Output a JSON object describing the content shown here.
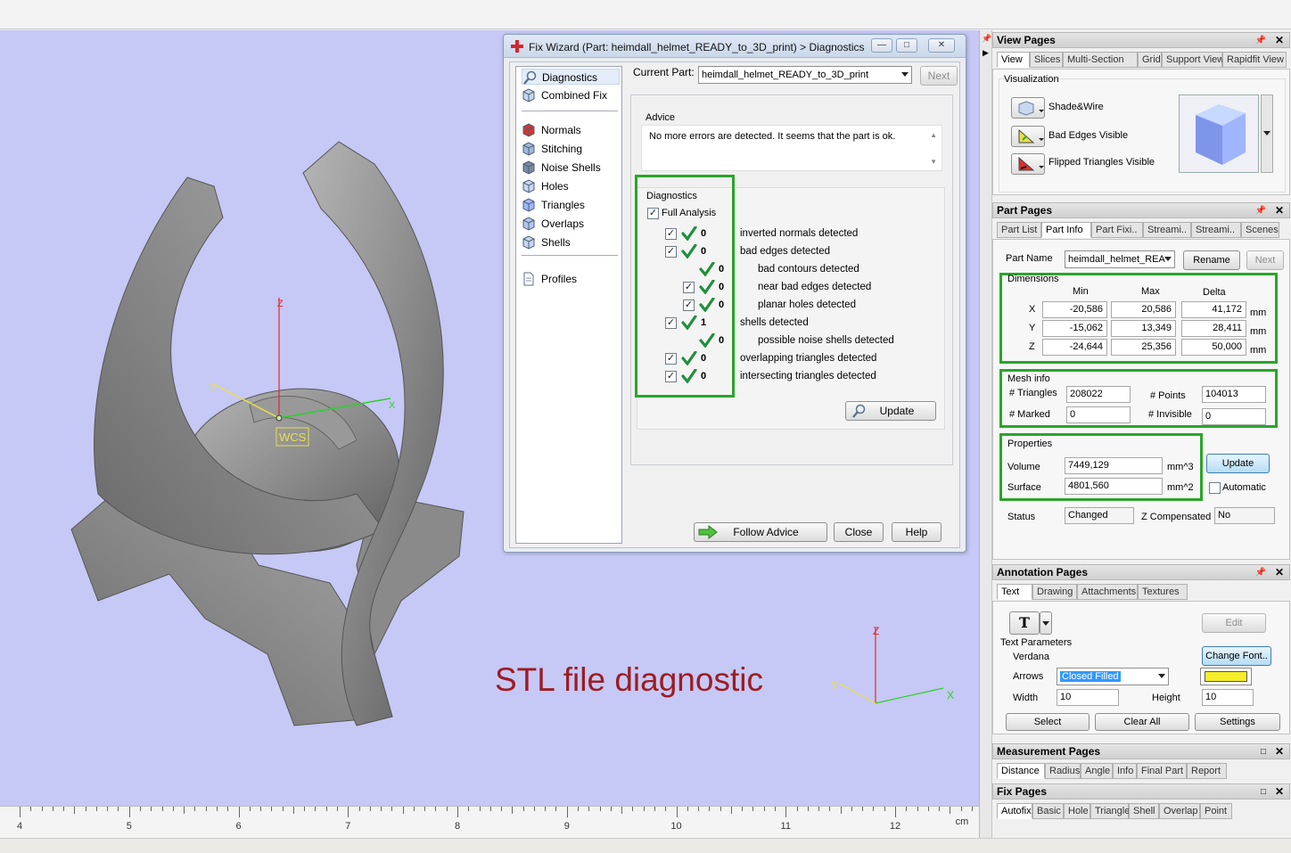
{
  "overlay_caption": "STL file diagnostic",
  "viewport": {
    "wcs_label": "WCS",
    "axes": {
      "z": "Z",
      "y": "Y",
      "x": "X"
    },
    "ruler_ticks": [
      "4",
      "5",
      "6",
      "7",
      "8",
      "9",
      "10",
      "11",
      "12"
    ],
    "ruler_unit": "cm",
    "colors": {
      "background": "#c6c8f5",
      "model": "#8f8f8f",
      "x_axis": "#2bd12b",
      "y_axis": "#e8e04a",
      "z_axis": "#e0282e"
    }
  },
  "dialog": {
    "title": "Fix Wizard (Part: heimdall_helmet_READY_to_3D_print) > Diagnostics",
    "nav": {
      "top": [
        {
          "label": "Diagnostics",
          "icon": "magnifier-icon"
        },
        {
          "label": "Combined Fix",
          "icon": "cube-icon"
        }
      ],
      "fixes": [
        {
          "label": "Normals",
          "icon": "normals-cube-icon"
        },
        {
          "label": "Stitching",
          "icon": "stitching-icon"
        },
        {
          "label": "Noise Shells",
          "icon": "noise-shells-icon"
        },
        {
          "label": "Holes",
          "icon": "holes-cube-icon"
        },
        {
          "label": "Triangles",
          "icon": "triangles-cube-icon"
        },
        {
          "label": "Overlaps",
          "icon": "overlaps-icon"
        },
        {
          "label": "Shells",
          "icon": "shells-cube-icon"
        }
      ],
      "profiles": {
        "label": "Profiles",
        "icon": "document-icon"
      }
    },
    "current_part_label": "Current Part:",
    "current_part_value": "heimdall_helmet_READY_to_3D_print",
    "next_label": "Next",
    "advice": {
      "title": "Advice",
      "text": "No more errors are detected. It seems that the part is ok."
    },
    "diagnostics": {
      "title": "Diagnostics",
      "full_analysis": "Full Analysis",
      "rows": [
        {
          "checkbox": true,
          "value": "0",
          "label": "inverted normals detected",
          "indent": 0
        },
        {
          "checkbox": true,
          "value": "0",
          "label": "bad edges detected",
          "indent": 0
        },
        {
          "checkbox": false,
          "value": "0",
          "label": "bad contours detected",
          "indent": 1
        },
        {
          "checkbox": true,
          "value": "0",
          "label": "near bad edges detected",
          "indent": 1
        },
        {
          "checkbox": true,
          "value": "0",
          "label": "planar holes detected",
          "indent": 1
        },
        {
          "checkbox": true,
          "value": "1",
          "label": "shells detected",
          "indent": 0
        },
        {
          "checkbox": false,
          "value": "0",
          "label": "possible noise shells detected",
          "indent": 1
        },
        {
          "checkbox": true,
          "value": "0",
          "label": "overlapping triangles detected",
          "indent": 0
        },
        {
          "checkbox": true,
          "value": "0",
          "label": "intersecting triangles detected",
          "indent": 0
        }
      ],
      "update_label": "Update"
    },
    "buttons": {
      "follow_advice": "Follow Advice",
      "close": "Close",
      "help": "Help"
    }
  },
  "view_pages": {
    "title": "View Pages",
    "tabs": [
      "View",
      "Slices",
      "Multi-Section",
      "Grid",
      "Support View",
      "Rapidfit View"
    ],
    "visualization_title": "Visualization",
    "items": [
      "Shade&Wire",
      "Bad Edges Visible",
      "Flipped Triangles Visible"
    ]
  },
  "part_pages": {
    "title": "Part Pages",
    "tabs": [
      "Part List",
      "Part Info",
      "Part Fixi..",
      "Streami..",
      "Streami..",
      "Scenes"
    ],
    "part_name_label": "Part Name",
    "part_name_value": "heimdall_helmet_REA",
    "rename": "Rename",
    "next": "Next",
    "dimensions": {
      "title": "Dimensions",
      "headers": [
        "Min",
        "Max",
        "Delta"
      ],
      "rows": [
        {
          "axis": "X",
          "min": "-20,586",
          "max": "20,586",
          "delta": "41,172",
          "unit": "mm"
        },
        {
          "axis": "Y",
          "min": "-15,062",
          "max": "13,349",
          "delta": "28,411",
          "unit": "mm"
        },
        {
          "axis": "Z",
          "min": "-24,644",
          "max": "25,356",
          "delta": "50,000",
          "unit": "mm"
        }
      ]
    },
    "mesh": {
      "title": "Mesh info",
      "triangles_label": "# Triangles",
      "triangles": "208022",
      "points_label": "# Points",
      "points": "104013",
      "marked_label": "# Marked",
      "marked": "0",
      "invisible_label": "# Invisible",
      "invisible": "0"
    },
    "properties": {
      "title": "Properties",
      "volume_label": "Volume",
      "volume": "7449,129",
      "volume_unit": "mm^3",
      "surface_label": "Surface",
      "surface": "4801,560",
      "surface_unit": "mm^2",
      "update": "Update",
      "automatic": "Automatic"
    },
    "status_label": "Status",
    "status": "Changed",
    "zcomp_label": "Z Compensated",
    "zcomp": "No"
  },
  "annotation_pages": {
    "title": "Annotation Pages",
    "tabs": [
      "Text",
      "Drawing",
      "Attachments",
      "Textures"
    ],
    "text_icon": "T",
    "edit": "Edit",
    "params_title": "Text Parameters",
    "font": "Verdana",
    "change_font": "Change Font..",
    "arrows_label": "Arrows",
    "arrows_value": "Closed Filled",
    "width_label": "Width",
    "width": "10",
    "height_label": "Height",
    "height": "10",
    "color": "#f5ee2a",
    "select": "Select",
    "clear_all": "Clear All",
    "settings": "Settings"
  },
  "measurement_pages": {
    "title": "Measurement Pages",
    "tabs": [
      "Distance",
      "Radius",
      "Angle",
      "Info",
      "Final Part",
      "Report"
    ]
  },
  "fix_pages": {
    "title": "Fix Pages",
    "tabs": [
      "Autofix",
      "Basic",
      "Hole",
      "Triangle",
      "Shell",
      "Overlap",
      "Point"
    ]
  },
  "highlight_color": "#2aa52a"
}
